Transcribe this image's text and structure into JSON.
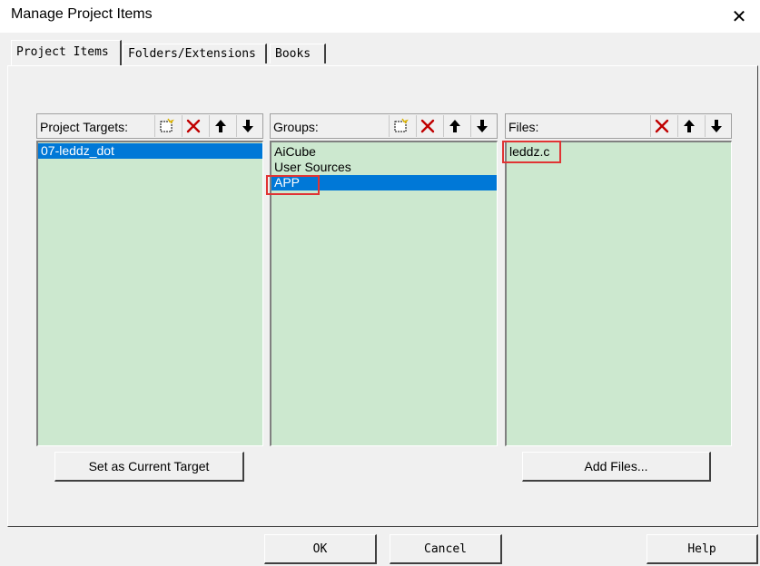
{
  "window": {
    "title": "Manage Project Items",
    "close_symbol": "✕"
  },
  "tabs": [
    {
      "label": "Project Items",
      "active": true
    },
    {
      "label": "Folders/Extensions",
      "active": false
    },
    {
      "label": "Books",
      "active": false
    }
  ],
  "targets": {
    "label": "Project Targets:",
    "items": [
      "07-leddz_dot"
    ],
    "selected_index": 0,
    "set_current_button": "Set as Current Target"
  },
  "groups": {
    "label": "Groups:",
    "items": [
      "AiCube",
      "User Sources",
      "APP"
    ],
    "selected_index": 2
  },
  "files": {
    "label": "Files:",
    "items": [
      "leddz.c"
    ],
    "add_files_button": "Add Files..."
  },
  "footer": {
    "ok": "OK",
    "cancel": "Cancel",
    "help": "Help"
  },
  "colors": {
    "list_bg": "#cce8cf",
    "selection": "#0078d7",
    "highlight": "#e03434",
    "delete_icon": "#c00000"
  }
}
